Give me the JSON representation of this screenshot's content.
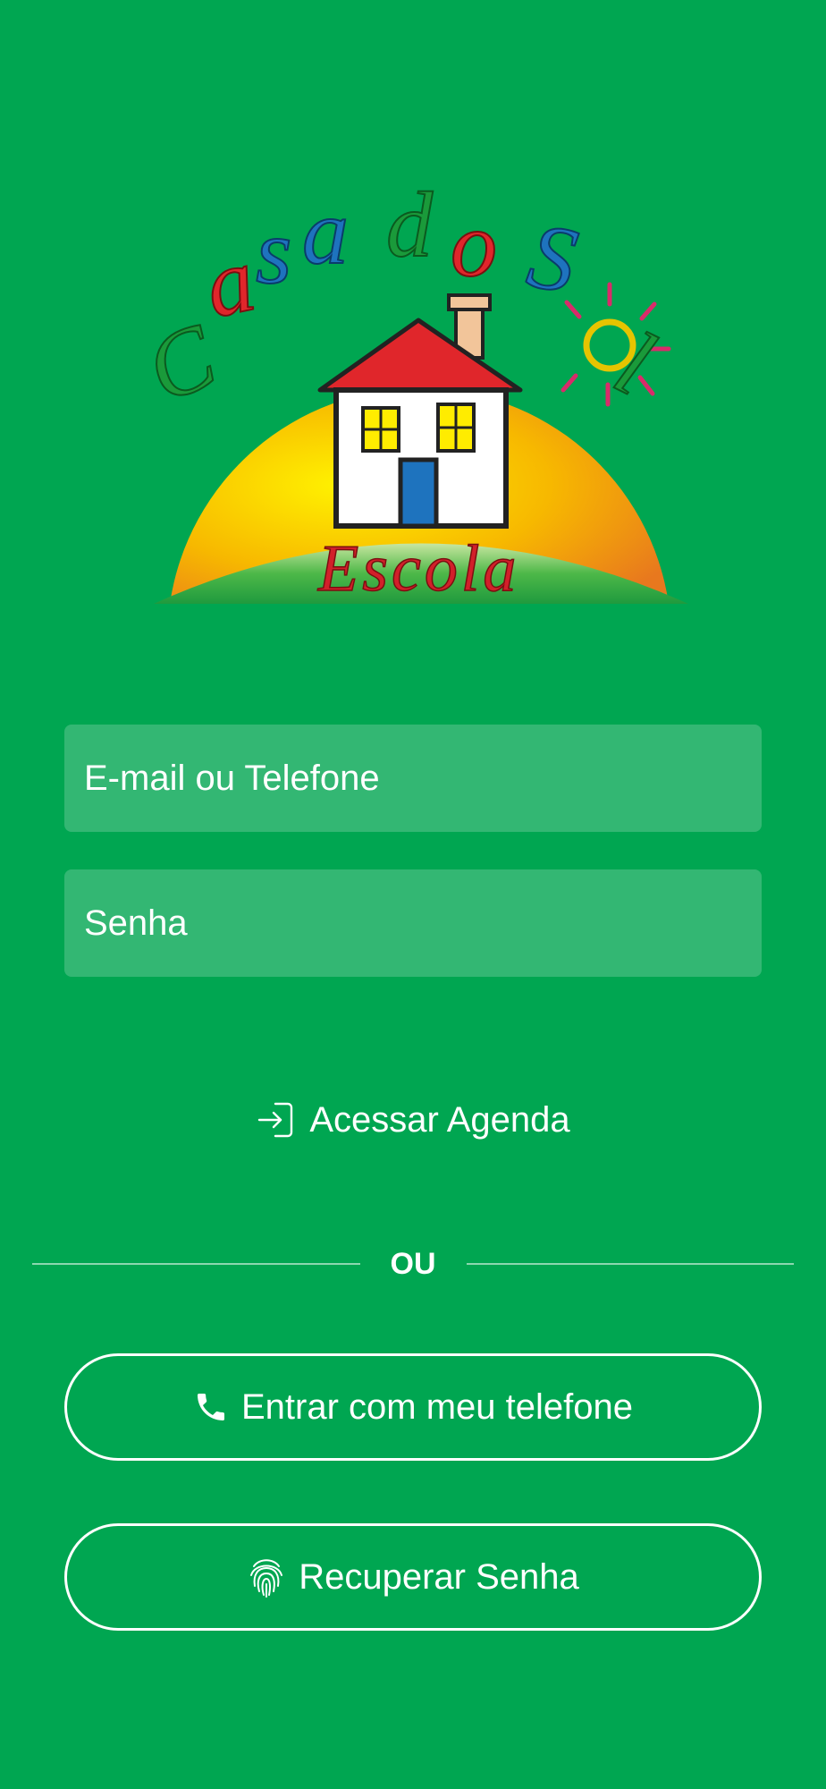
{
  "logo": {
    "brand_top": "Casa do Sol",
    "brand_bottom": "Escola"
  },
  "form": {
    "email_placeholder": "E-mail ou Telefone",
    "password_placeholder": "Senha"
  },
  "actions": {
    "access_label": "Acessar Agenda",
    "access_icon": "login-icon",
    "divider_label": "OU",
    "phone_label": "Entrar com meu telefone",
    "phone_icon": "phone-icon",
    "recover_label": "Recuperar Senha",
    "recover_icon": "fingerprint-icon"
  },
  "colors": {
    "background": "#00a651",
    "field_fill": "rgba(255,255,255,0.2)",
    "text": "#ffffff"
  }
}
